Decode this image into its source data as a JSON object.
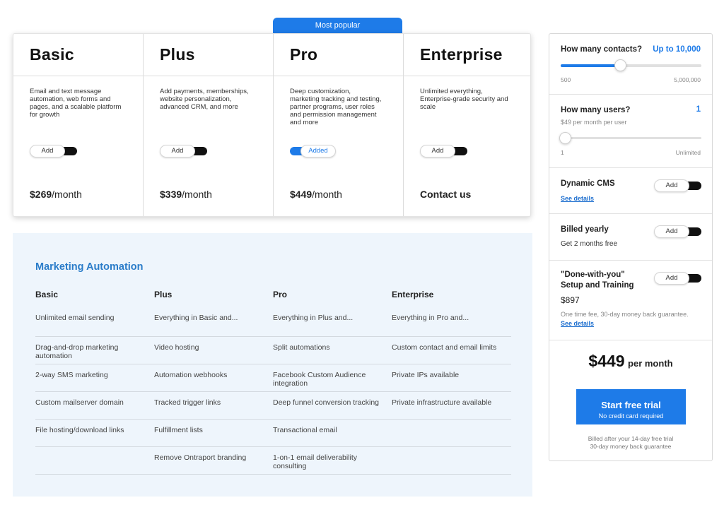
{
  "popular_label": "Most popular",
  "plans": [
    {
      "name": "Basic",
      "description": "Email and text message automation, web forms and pages, and a scalable platform for growth",
      "toggle_label": "Add",
      "toggle_on": false,
      "price_amount": "$269",
      "price_unit": "/month"
    },
    {
      "name": "Plus",
      "description": "Add payments, memberships, website personalization, advanced CRM, and more",
      "toggle_label": "Add",
      "toggle_on": false,
      "price_amount": "$339",
      "price_unit": "/month"
    },
    {
      "name": "Pro",
      "description": "Deep customization, marketing tracking and testing, partner programs, user roles and permission management and more",
      "toggle_label": "Added",
      "toggle_on": true,
      "price_amount": "$449",
      "price_unit": "/month"
    },
    {
      "name": "Enterprise",
      "description": "Unlimited everything, Enterprise-grade security and scale",
      "toggle_label": "Add",
      "toggle_on": false,
      "price_amount": "Contact us",
      "price_unit": ""
    }
  ],
  "features": {
    "title": "Marketing Automation",
    "columns": [
      "Basic",
      "Plus",
      "Pro",
      "Enterprise"
    ],
    "rows": [
      [
        "Unlimited email sending",
        "Everything in Basic and...",
        "Everything in Plus and...",
        "Everything in Pro and..."
      ],
      [
        "Drag-and-drop marketing automation",
        "Video hosting",
        "Split automations",
        "Custom contact and email limits"
      ],
      [
        "2-way SMS marketing",
        "Automation webhooks",
        "Facebook Custom Audience integration",
        "Private IPs available"
      ],
      [
        "Custom mailserver domain",
        "Tracked trigger links",
        "Deep funnel conversion tracking",
        "Private infrastructure available"
      ],
      [
        "File hosting/download links",
        "Fulfillment lists",
        "Transactional email",
        ""
      ],
      [
        "",
        "Remove Ontraport branding",
        "1-on-1 email deliverability consulting",
        ""
      ]
    ]
  },
  "sidebar": {
    "contacts": {
      "label": "How many contacts?",
      "value": "Up to 10,000",
      "min": "500",
      "max": "5,000,000",
      "level": 0.42
    },
    "users": {
      "label": "How many users?",
      "value": "1",
      "sub": "$49 per month per user",
      "min": "1",
      "max": "Unlimited",
      "level": 0.0
    },
    "cms": {
      "label": "Dynamic CMS",
      "link": "See details",
      "toggle_label": "Add"
    },
    "billing": {
      "label": "Billed yearly",
      "sub": "Get 2 months free",
      "toggle_label": "Add"
    },
    "training": {
      "label_line1": "\"Done-with-you\"",
      "label_line2": "Setup and Training",
      "price": "$897",
      "note": "One time fee, 30-day money back guarantee.",
      "link": "See details",
      "toggle_label": "Add"
    },
    "total": {
      "amount": "$449",
      "per": "per month"
    },
    "cta": {
      "title": "Start free trial",
      "subtitle": "No credit card required"
    },
    "fine_line1": "Billed after your 14-day free trial",
    "fine_line2": "30-day money back guarantee"
  }
}
